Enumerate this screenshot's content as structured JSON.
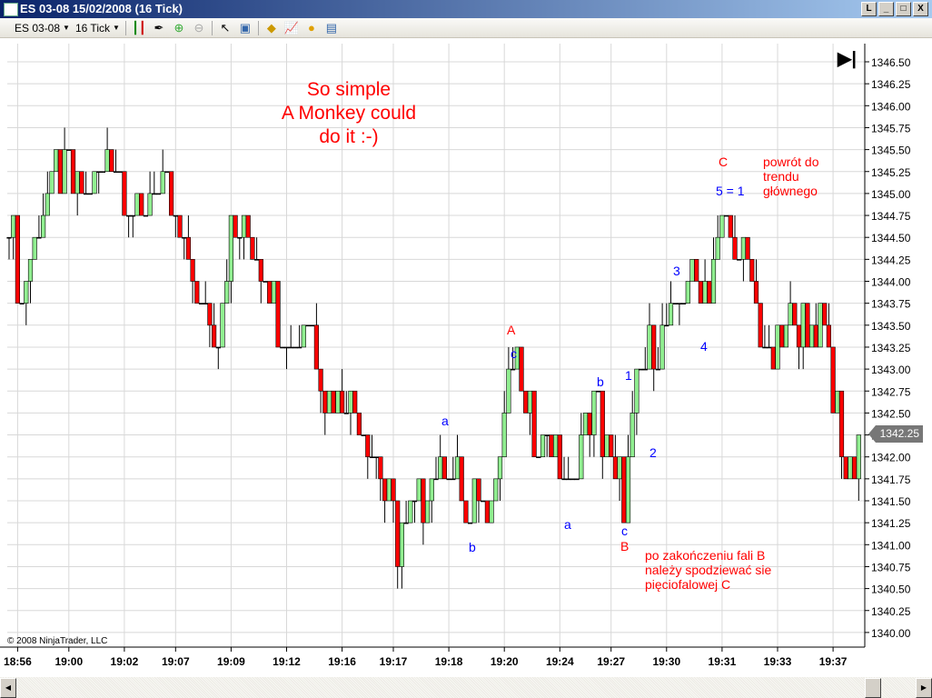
{
  "window": {
    "title": "ES 03-08  15/02/2008 (16 Tick)",
    "buttons": [
      "L",
      "_",
      "□",
      "X"
    ]
  },
  "toolbar": {
    "instrument": "ES 03-08",
    "interval": "16 Tick"
  },
  "chart_data": {
    "type": "candlestick",
    "title": "ES 03-08 15/02/2008 (16 Tick)",
    "ylim": [
      1339.75,
      1346.75
    ],
    "yticks": [
      "1346.50",
      "1346.25",
      "1346.00",
      "1345.75",
      "1345.50",
      "1345.25",
      "1345.00",
      "1344.75",
      "1344.50",
      "1344.25",
      "1344.00",
      "1343.75",
      "1343.50",
      "1343.25",
      "1343.00",
      "1342.75",
      "1342.50",
      "1342.25",
      "1342.00",
      "1341.75",
      "1341.50",
      "1341.25",
      "1341.00",
      "1340.75",
      "1340.50",
      "1340.25",
      "1340.00"
    ],
    "xticks": [
      [
        "18:56",
        2
      ],
      [
        "19:00",
        14
      ],
      [
        "19:02",
        27
      ],
      [
        "19:07",
        39
      ],
      [
        "19:09",
        52
      ],
      [
        "19:12",
        65
      ],
      [
        "19:16",
        78
      ],
      [
        "19:17",
        90
      ],
      [
        "19:18",
        103
      ],
      [
        "19:20",
        116
      ],
      [
        "19:24",
        129
      ],
      [
        "19:27",
        141
      ],
      [
        "19:30",
        154
      ],
      [
        "19:31",
        167
      ],
      [
        "19:33",
        180
      ],
      [
        "19:37",
        193
      ]
    ],
    "bar_count": 200,
    "close_path": [
      [
        0,
        1344.75
      ],
      [
        3,
        1343.75
      ],
      [
        6,
        1344.5
      ],
      [
        11,
        1345.25
      ],
      [
        17,
        1345.0
      ],
      [
        22,
        1345.25
      ],
      [
        24,
        1345.5
      ],
      [
        29,
        1344.75
      ],
      [
        36,
        1345.0
      ],
      [
        40,
        1344.5
      ],
      [
        44,
        1343.75
      ],
      [
        49,
        1343.5
      ],
      [
        52,
        1344.5
      ],
      [
        60,
        1344.25
      ],
      [
        63,
        1343.5
      ],
      [
        67,
        1343.25
      ],
      [
        71,
        1343.5
      ],
      [
        74,
        1342.75
      ],
      [
        79,
        1342.75
      ],
      [
        84,
        1342.25
      ],
      [
        87,
        1341.75
      ],
      [
        91,
        1341.0
      ],
      [
        95,
        1341.5
      ],
      [
        100,
        1341.75
      ],
      [
        103,
        1342.0
      ],
      [
        107,
        1341.25
      ],
      [
        111,
        1341.5
      ],
      [
        114,
        1341.75
      ],
      [
        117,
        1342.75
      ],
      [
        119,
        1343.0
      ],
      [
        121,
        1342.5
      ],
      [
        128,
        1342.0
      ],
      [
        131,
        1341.5
      ],
      [
        134,
        1342.25
      ],
      [
        138,
        1342.5
      ],
      [
        144,
        1341.5
      ],
      [
        147,
        1342.75
      ],
      [
        151,
        1343.25
      ],
      [
        155,
        1343.5
      ],
      [
        160,
        1344.0
      ],
      [
        164,
        1344.0
      ],
      [
        167,
        1344.75
      ],
      [
        171,
        1344.25
      ],
      [
        175,
        1343.75
      ],
      [
        178,
        1343.0
      ],
      [
        181,
        1343.25
      ],
      [
        184,
        1343.75
      ],
      [
        187,
        1343.25
      ],
      [
        191,
        1343.75
      ],
      [
        193,
        1342.75
      ],
      [
        196,
        1341.75
      ],
      [
        199,
        1342.25
      ]
    ],
    "last_price": "1342.25",
    "colors": {
      "up": "#90ee90",
      "down": "#ff0000",
      "grid": "#d8d8d8"
    }
  },
  "annotations": {
    "headline": "So simple\nA Monkey could\ndo it :-)",
    "wave_labels": {
      "A": "A",
      "B": "B",
      "C": "C",
      "a1": "a",
      "b1": "b",
      "c1": "c",
      "a2": "a",
      "b2": "b",
      "c2": "c",
      "w1": "1",
      "w2": "2",
      "w3": "3",
      "w4": "4",
      "w5": "5 = 1"
    },
    "note_trend": "powrót do\ntrendu\ngłównego",
    "note_b": "po zakończeniu fali B\nnależy spodziewać sie\npięciofalowej C"
  },
  "footer": {
    "copyright": "© 2008 NinjaTrader, LLC"
  }
}
